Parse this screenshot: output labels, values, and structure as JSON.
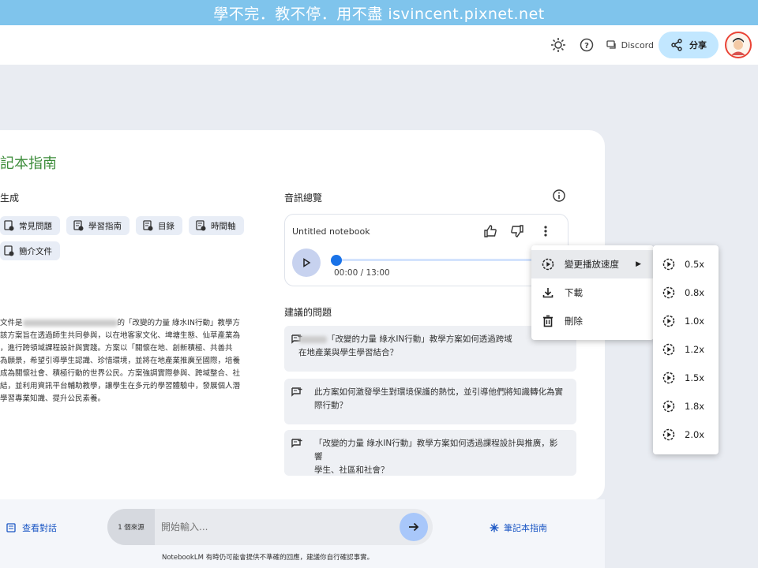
{
  "banner": "學不完．教不停．用不盡 isvincent.pixnet.net",
  "topbar": {
    "discord_label": "Discord",
    "share_label": "分享"
  },
  "card": {
    "title": "記本指南",
    "generate_label": "生成",
    "chips": [
      "常見問題",
      "學習指南",
      "目錄",
      "時間軸",
      "簡介文件"
    ],
    "description": {
      "p1a": "文件是",
      "p1b": "的「改變的力量 綠水IN行動」教學方",
      "lines": [
        "該方案旨在透過師生共同參與，以在地客家文化、埤塘生態、仙草產業為",
        "，進行跨領域課程設計與實踐。方案以「關懷在地、創新積極、共善共",
        "為願景，希望引導學生認識、珍惜環境，並將在地產業推廣至國際，培養",
        "成為關懷社會、積極行動的世界公民。方案強調實際參與、跨域整合、社",
        "結，並利用資訊平台輔助教學，讓學生在多元的學習體驗中，發展個人潛",
        "學習專業知識、提升公民素養。"
      ]
    }
  },
  "audio": {
    "section_label": "音訊總覽",
    "notebook_title": "Untitled notebook",
    "time": "00:00 / 13:00",
    "progress": 0
  },
  "suggestions": {
    "label": "建議的問題",
    "items": [
      {
        "line1": "「改變的力量 綠水IN行動」教學方案如何透過跨域",
        "line2": "在地產業與學生學習結合？"
      },
      {
        "line1": "此方案如何激發學生對環境保護的熱忱，並引導他們將知識轉化為實",
        "line2": "際行動？"
      },
      {
        "line1": "「改變的力量 綠水IN行動」教學方案如何透過課程設計與推廣，影響",
        "line2": "學生、社區和社會？"
      }
    ]
  },
  "bottom": {
    "view_chat": "查看對話",
    "source_count": "1 個來源",
    "input_placeholder": "開始輸入...",
    "notebook_guide": "筆記本指南",
    "disclaimer": "NotebookLM 有時仍可能會提供不準確的回應，建議你自行確認事實。"
  },
  "menu": {
    "items": [
      "變更播放速度",
      "下載",
      "刪除"
    ]
  },
  "speeds": [
    "0.5x",
    "0.8x",
    "1.0x",
    "1.2x",
    "1.5x",
    "1.8x",
    "2.0x"
  ]
}
